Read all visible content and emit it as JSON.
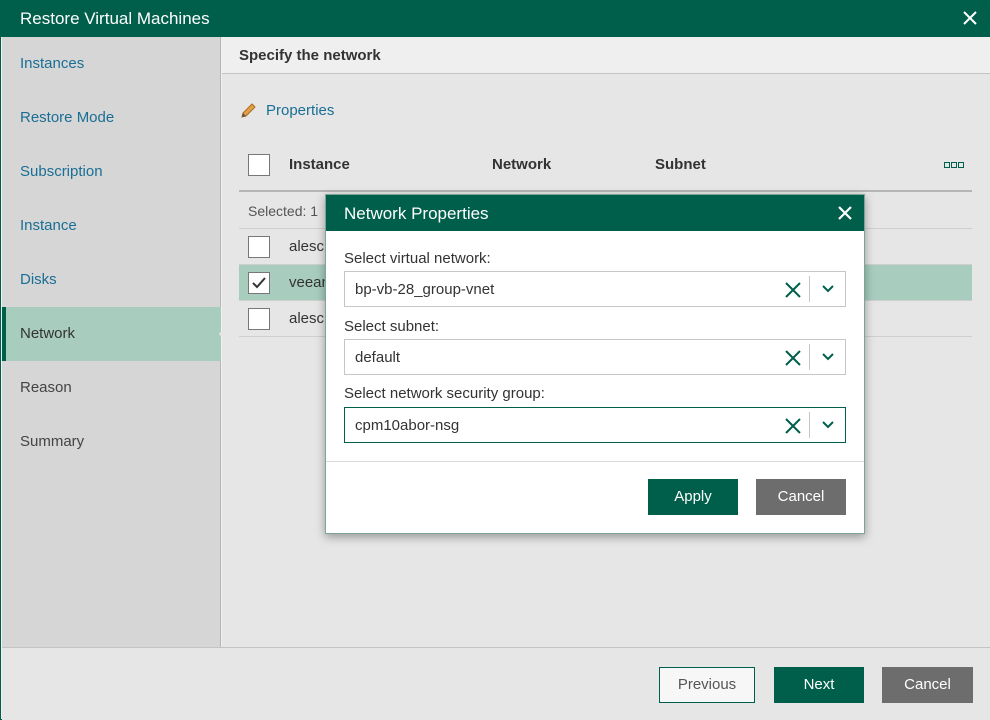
{
  "window": {
    "title": "Restore Virtual Machines"
  },
  "sidebar": {
    "items": [
      {
        "label": "Instances"
      },
      {
        "label": "Restore Mode"
      },
      {
        "label": "Subscription"
      },
      {
        "label": "Instance"
      },
      {
        "label": "Disks"
      },
      {
        "label": "Network"
      },
      {
        "label": "Reason"
      },
      {
        "label": "Summary"
      }
    ],
    "active_index": 5
  },
  "main": {
    "section_title": "Specify the network",
    "properties_label": "Properties",
    "table": {
      "columns": [
        "Instance",
        "Network",
        "Subnet"
      ],
      "selected_text": "Selected: 1",
      "rows": [
        {
          "instance": "alesch",
          "checked": false,
          "selected": false
        },
        {
          "instance": "veean",
          "checked": true,
          "selected": true
        },
        {
          "instance": "alesch",
          "checked": false,
          "selected": false
        }
      ]
    }
  },
  "dialog": {
    "title": "Network Properties",
    "virtual_network_label": "Select virtual network:",
    "virtual_network_value": "bp-vb-28_group-vnet",
    "subnet_label": "Select subnet:",
    "subnet_value": "default",
    "nsg_label": "Select network security group:",
    "nsg_value": "cpm10abor-nsg",
    "apply_label": "Apply",
    "cancel_label": "Cancel"
  },
  "footer": {
    "previous_label": "Previous",
    "next_label": "Next",
    "cancel_label": "Cancel"
  },
  "colors": {
    "brand": "#005f4b",
    "selection": "#a8cdbf",
    "link": "#1a6e95"
  },
  "icons": [
    "close-icon",
    "pencil-icon",
    "more-icon",
    "checkmark-icon",
    "clear-icon",
    "chevron-down-icon"
  ]
}
